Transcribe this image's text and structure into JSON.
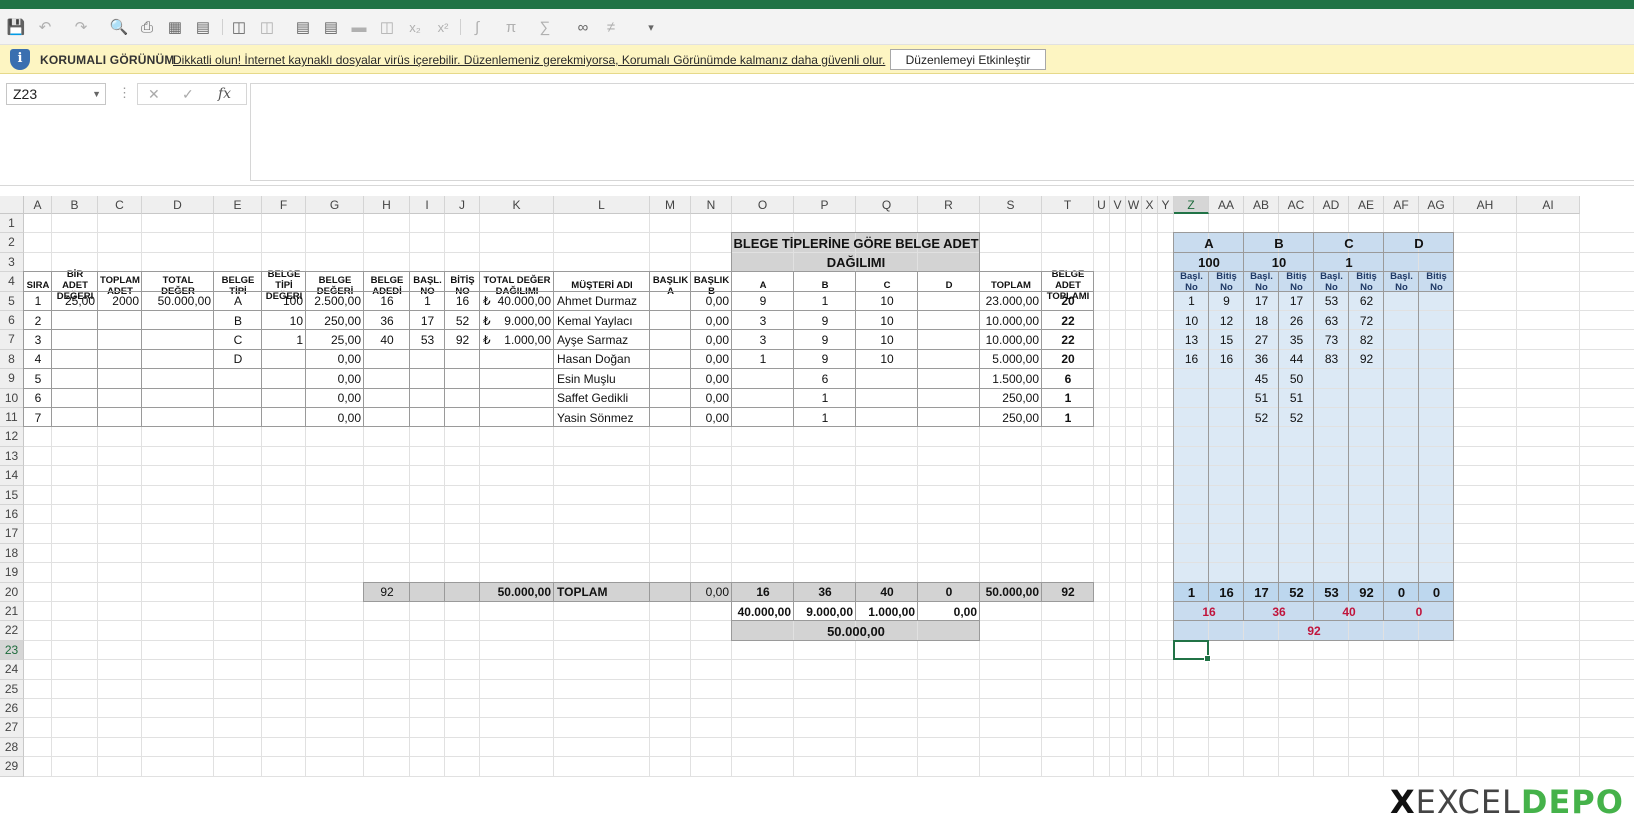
{
  "ribbon": {
    "icons": [
      "save-icon",
      "undo-icon",
      "redo-icon",
      "print-preview-icon",
      "print-icon",
      "borders-icon",
      "borders2-icon",
      "camera-icon",
      "format-icon",
      "sort-icon",
      "text-box-icon",
      "merge-icon",
      "unmerge-icon",
      "subscript-icon",
      "superscript-icon",
      "integral-icon",
      "pi-icon",
      "sigma-icon",
      "infinity-icon",
      "not-equal-icon",
      "customize-icon"
    ]
  },
  "protected_view": {
    "title": "KORUMALI GÖRÜNÜM",
    "message": "Dikkatli olun! İnternet kaynaklı dosyalar virüs içerebilir. Düzenlemeniz gerekmiyorsa, Korumalı Görünümde kalmanız daha güvenli olur.",
    "button": "Düzenlemeyi Etkinleştir"
  },
  "formula_bar": {
    "name_box": "Z23",
    "cancel_glyph": "✕",
    "enter_glyph": "✓",
    "fx_glyph": "fx",
    "formula": ""
  },
  "sheet": {
    "columns": [
      "A",
      "B",
      "C",
      "D",
      "E",
      "F",
      "G",
      "H",
      "I",
      "J",
      "K",
      "L",
      "M",
      "N",
      "O",
      "P",
      "Q",
      "R",
      "S",
      "T",
      "U",
      "V",
      "W",
      "X",
      "Y",
      "Z",
      "AA",
      "AB",
      "AC",
      "AD",
      "AE",
      "AF",
      "AG",
      "AH",
      "AI"
    ],
    "rows": [
      "1",
      "2",
      "3",
      "4",
      "5",
      "6",
      "7",
      "8",
      "9",
      "10",
      "11",
      "12",
      "13",
      "14",
      "15",
      "16",
      "17",
      "18",
      "19",
      "20",
      "21",
      "22",
      "23",
      "24",
      "25",
      "26",
      "27",
      "28",
      "29"
    ],
    "active_cell": "Z23",
    "title_line1": "BLEGE TİPLERİNE GÖRE BELGE ADET",
    "title_line2": "DAĞILIMI",
    "headers": {
      "sira": "SIRA",
      "bir_adet": "BİR ADET DEĞERİ",
      "toplam_adet": "TOPLAM ADET",
      "total_deger": "TOTAL DEĞER",
      "belge_tipi": "BELGE TİPİ",
      "belge_tipi_degeri": "BELGE TİPİ DEĞERİ",
      "belge_degeri": "BELGE DEĞERİ",
      "belge_adedi": "BELGE ADEDİ",
      "basl_no": "BAŞL. NO",
      "bitis_no": "BİTİŞ NO",
      "total_deger_dagilimi": "TOTAL DEĞER DAĞILIMI",
      "musteri_adi": "MÜŞTERİ ADI",
      "baslik_a": "BAŞLIK A",
      "baslik_b": "BAŞLIK B",
      "dist_a": "A",
      "dist_b": "B",
      "dist_c": "C",
      "dist_d": "D",
      "toplam": "TOPLAM",
      "belge_adet_toplami": "BELGE ADET TOPLAMI"
    },
    "rows_data": [
      {
        "sira": "1",
        "bir": "25,00",
        "top_adet": "2000",
        "total": "50.000,00",
        "tip": "A",
        "tip_deg": "100",
        "deger": "2.500,00",
        "adet": "16",
        "basl": "1",
        "bitis": "16",
        "dag_cur": "₺",
        "dag": "40.000,00",
        "musteri": "Ahmet Durmaz",
        "bb": "0,00",
        "a": "9",
        "b": "1",
        "c": "10",
        "d": "",
        "toplam": "23.000,00",
        "adet_top": "20"
      },
      {
        "sira": "2",
        "bir": "",
        "top_adet": "",
        "total": "",
        "tip": "B",
        "tip_deg": "10",
        "deger": "250,00",
        "adet": "36",
        "basl": "17",
        "bitis": "52",
        "dag_cur": "₺",
        "dag": "9.000,00",
        "musteri": "Kemal Yaylacı",
        "bb": "0,00",
        "a": "3",
        "b": "9",
        "c": "10",
        "d": "",
        "toplam": "10.000,00",
        "adet_top": "22"
      },
      {
        "sira": "3",
        "bir": "",
        "top_adet": "",
        "total": "",
        "tip": "C",
        "tip_deg": "1",
        "deger": "25,00",
        "adet": "40",
        "basl": "53",
        "bitis": "92",
        "dag_cur": "₺",
        "dag": "1.000,00",
        "musteri": "Ayşe Sarmaz",
        "bb": "0,00",
        "a": "3",
        "b": "9",
        "c": "10",
        "d": "",
        "toplam": "10.000,00",
        "adet_top": "22"
      },
      {
        "sira": "4",
        "bir": "",
        "top_adet": "",
        "total": "",
        "tip": "D",
        "tip_deg": "",
        "deger": "0,00",
        "adet": "",
        "basl": "",
        "bitis": "",
        "dag_cur": "",
        "dag": "",
        "musteri": "Hasan Doğan",
        "bb": "0,00",
        "a": "1",
        "b": "9",
        "c": "10",
        "d": "",
        "toplam": "5.000,00",
        "adet_top": "20"
      },
      {
        "sira": "5",
        "bir": "",
        "top_adet": "",
        "total": "",
        "tip": "",
        "tip_deg": "",
        "deger": "0,00",
        "adet": "",
        "basl": "",
        "bitis": "",
        "dag_cur": "",
        "dag": "",
        "musteri": "Esin Muşlu",
        "bb": "0,00",
        "a": "",
        "b": "6",
        "c": "",
        "d": "",
        "toplam": "1.500,00",
        "adet_top": "6"
      },
      {
        "sira": "6",
        "bir": "",
        "top_adet": "",
        "total": "",
        "tip": "",
        "tip_deg": "",
        "deger": "0,00",
        "adet": "",
        "basl": "",
        "bitis": "",
        "dag_cur": "",
        "dag": "",
        "musteri": "Saffet Gedikli",
        "bb": "0,00",
        "a": "",
        "b": "1",
        "c": "",
        "d": "",
        "toplam": "250,00",
        "adet_top": "1"
      },
      {
        "sira": "7",
        "bir": "",
        "top_adet": "",
        "total": "",
        "tip": "",
        "tip_deg": "",
        "deger": "0,00",
        "adet": "",
        "basl": "",
        "bitis": "",
        "dag_cur": "",
        "dag": "",
        "musteri": "Yasin Sönmez",
        "bb": "0,00",
        "a": "",
        "b": "1",
        "c": "",
        "d": "",
        "toplam": "250,00",
        "adet_top": "1"
      }
    ],
    "totals": {
      "adet": "92",
      "dag": "50.000,00",
      "label": "TOPLAM",
      "bb": "0,00",
      "a": "16",
      "b": "36",
      "c": "40",
      "d": "0",
      "toplam": "50.000,00",
      "adet_top": "92"
    },
    "value_row": {
      "a": "40.000,00",
      "b": "9.000,00",
      "c": "1.000,00",
      "d": "0,00"
    },
    "grand_total": "50.000,00",
    "right_table": {
      "groups": [
        {
          "label": "A",
          "value": "100"
        },
        {
          "label": "B",
          "value": "10"
        },
        {
          "label": "C",
          "value": "1"
        },
        {
          "label": "D",
          "value": ""
        }
      ],
      "sub_basl": "Başl. No",
      "sub_bitis": "Bitiş No",
      "rows": [
        [
          "1",
          "9",
          "17",
          "17",
          "53",
          "62",
          "",
          ""
        ],
        [
          "10",
          "12",
          "18",
          "26",
          "63",
          "72",
          "",
          ""
        ],
        [
          "13",
          "15",
          "27",
          "35",
          "73",
          "82",
          "",
          ""
        ],
        [
          "16",
          "16",
          "36",
          "44",
          "83",
          "92",
          "",
          ""
        ],
        [
          "",
          "",
          "45",
          "50",
          "",
          "",
          "",
          ""
        ],
        [
          "",
          "",
          "51",
          "51",
          "",
          "",
          "",
          ""
        ],
        [
          "",
          "",
          "52",
          "52",
          "",
          "",
          "",
          ""
        ]
      ],
      "totals": [
        "1",
        "16",
        "17",
        "52",
        "53",
        "92",
        "0",
        "0"
      ],
      "group_counts": [
        "16",
        "36",
        "40",
        "0"
      ],
      "grand": "92"
    }
  },
  "watermark": {
    "x": "X",
    "excel": "EXCEL",
    "depo": "DEPO"
  }
}
